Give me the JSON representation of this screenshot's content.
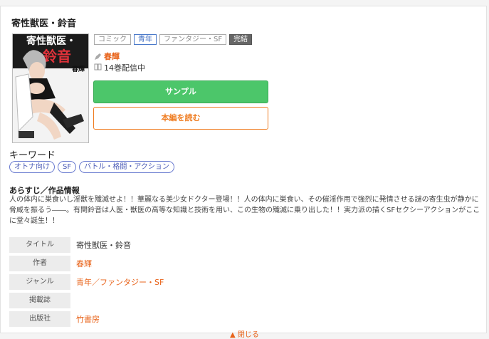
{
  "product": {
    "title": "寄性獣医・鈴音",
    "badges": [
      "コミック",
      "青年",
      "ファンタジー・SF",
      "完結"
    ],
    "author": "春輝",
    "volumes": "14巻配信中",
    "sample_button": "サンプル",
    "read_button": "本編を読む",
    "cover_text": {
      "title_line1": "寄性獣医・",
      "title_line2": "鈴音",
      "author": "春輝"
    }
  },
  "keywords": {
    "heading": "キーワード",
    "tags": [
      "オトナ向け",
      "SF",
      "バトル・格闘・アクション"
    ]
  },
  "synopsis": {
    "heading": "あらすじ／作品情報",
    "text": "人の体内に巣食いし淫獣を殲滅せよ！！華麗なる美少女ドクター登場！！人の体内に巣食い、その催淫作用で強烈に発情させる謎の寄生虫が静かに脅威を振るう――。有関鈴音は人医・獣医の高等な知識と技術を用い、この生物の殲滅に乗り出した！！実力派の描くSFセクシーアクションがここに堂々誕生！！"
  },
  "info": {
    "rows": [
      {
        "label": "タイトル",
        "value": "寄性獣医・鈴音"
      },
      {
        "label": "作者",
        "value": "春輝"
      },
      {
        "label": "ジャンル",
        "value": "青年／ファンタジー・SF"
      },
      {
        "label": "掲載誌",
        "value": ""
      },
      {
        "label": "出版社",
        "value": "竹書房"
      }
    ]
  },
  "more_link": "▲ 閉じる",
  "colors": {
    "accent_orange": "#e8631a",
    "sample_green": "#4cc66a",
    "tag_blue": "#4e5eb8"
  }
}
